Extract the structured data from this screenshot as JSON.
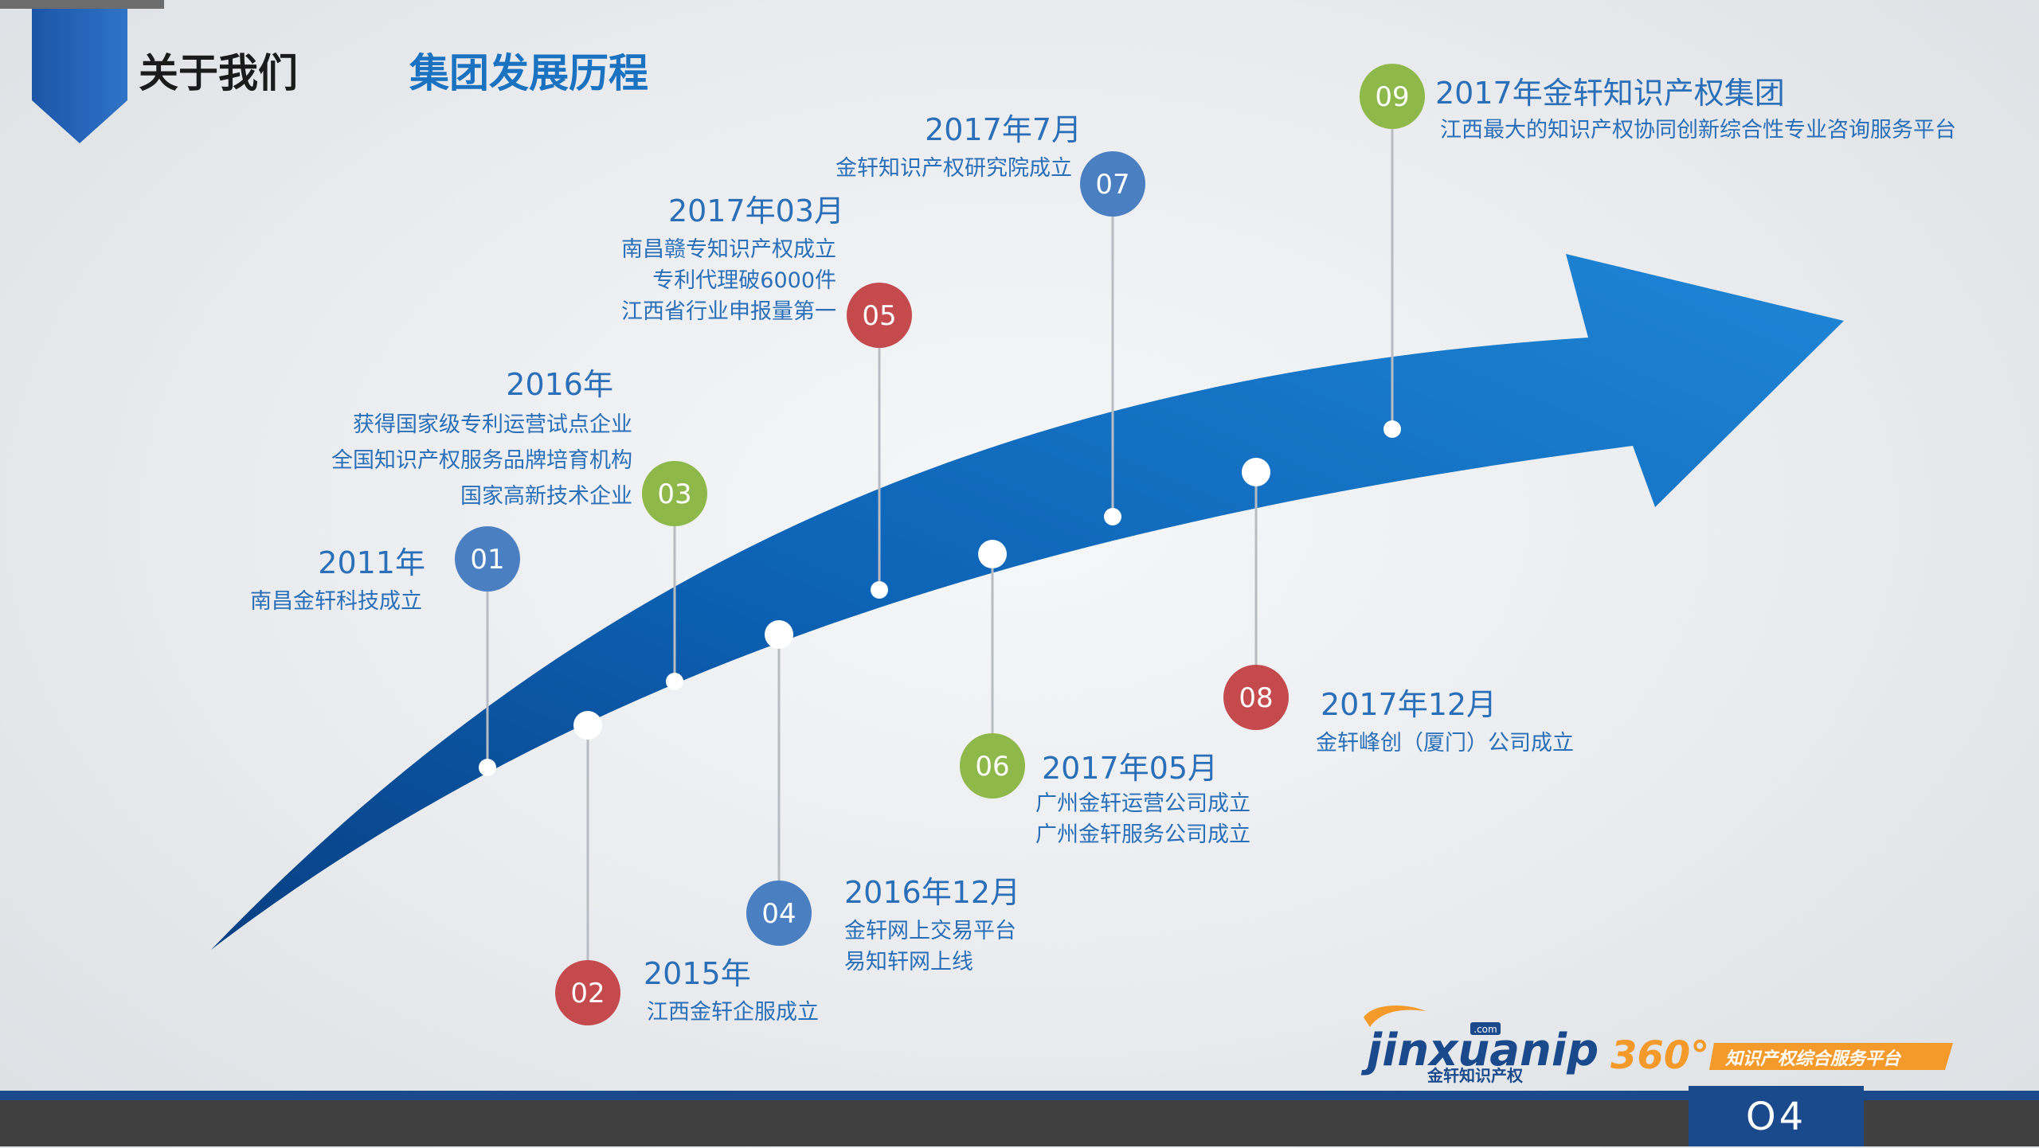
{
  "header": {
    "title": "关于我们",
    "subtitle": "集团发展历程"
  },
  "milestones": [
    {
      "num": "01",
      "year": "2011年",
      "lines": [
        "南昌金轩科技成立"
      ],
      "color": "#4a7fc1"
    },
    {
      "num": "02",
      "year": "2015年",
      "lines": [
        "江西金轩企服成立"
      ],
      "color": "#c44a4d"
    },
    {
      "num": "03",
      "year": "2016年",
      "lines": [
        "获得国家级专利运营试点企业",
        "全国知识产权服务品牌培育机构",
        "国家高新技术企业"
      ],
      "color": "#8fb84a"
    },
    {
      "num": "04",
      "year": "2016年12月",
      "lines": [
        "金轩网上交易平台",
        "易知轩网上线"
      ],
      "color": "#4a7fc1"
    },
    {
      "num": "05",
      "year": "2017年03月",
      "lines": [
        "南昌赣专知识产权成立",
        "专利代理破6000件",
        "江西省行业申报量第一"
      ],
      "color": "#c44a4d"
    },
    {
      "num": "06",
      "year": "2017年05月",
      "lines": [
        "广州金轩运营公司成立",
        "广州金轩服务公司成立"
      ],
      "color": "#8fb84a"
    },
    {
      "num": "07",
      "year": "2017年7月",
      "lines": [
        "金轩知识产权研究院成立"
      ],
      "color": "#4a7fc1"
    },
    {
      "num": "08",
      "year": "2017年12月",
      "lines": [
        "金轩峰创（厦门）公司成立"
      ],
      "color": "#c44a4d"
    },
    {
      "num": "09",
      "year": "2017年金轩知识产权集团",
      "lines": [
        "江西最大的知识产权协同创新综合性专业咨询服务平台"
      ],
      "color": "#8fb84a"
    }
  ],
  "footer": {
    "logo_main": "jinxuanip",
    "logo_com": ".com",
    "logo_cn": "金轩知识产权",
    "badge_num": "360°",
    "badge_text": "知识产权综合服务平台",
    "page_number": "O4"
  },
  "colors": {
    "accent": "#1a72c0",
    "arrow_dark": "#0a4f96",
    "arrow_light": "#1f86d6",
    "text_blue": "#2a6fb8",
    "red": "#c44a4d",
    "green": "#8fb84a",
    "blue": "#4a7fc1",
    "orange": "#f39a2b"
  }
}
